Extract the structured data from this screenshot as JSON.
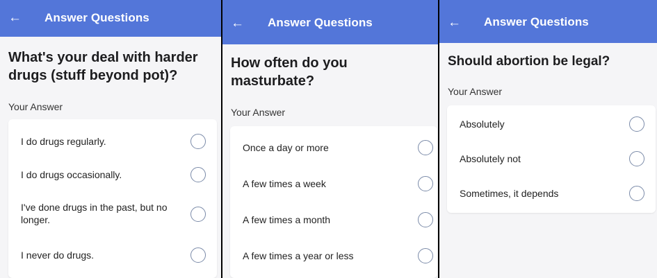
{
  "colors": {
    "appbar": "#5376d9",
    "background": "#f5f5f7",
    "card": "#ffffff",
    "radio_border": "#7a8aa8"
  },
  "screens": [
    {
      "appbar": {
        "back_icon": "arrow-left-icon",
        "back_glyph": "←",
        "title": "Answer Questions"
      },
      "question": "What's your deal with harder drugs (stuff beyond pot)?",
      "answer_label": "Your Answer",
      "options": [
        "I do drugs regularly.",
        "I do drugs occasionally.",
        "I've done drugs in the past, but no longer.",
        "I never do drugs."
      ]
    },
    {
      "appbar": {
        "back_icon": "arrow-left-icon",
        "back_glyph": "←",
        "title": "Answer Questions"
      },
      "question": "How often do you masturbate?",
      "answer_label": "Your Answer",
      "options": [
        "Once a day or more",
        "A few times a week",
        "A few times a month",
        "A few times a year or less"
      ]
    },
    {
      "appbar": {
        "back_icon": "arrow-left-icon",
        "back_glyph": "←",
        "title": "Answer Questions"
      },
      "question": "Should abortion be legal?",
      "answer_label": "Your Answer",
      "options": [
        "Absolutely",
        "Absolutely not",
        "Sometimes, it depends"
      ]
    }
  ]
}
